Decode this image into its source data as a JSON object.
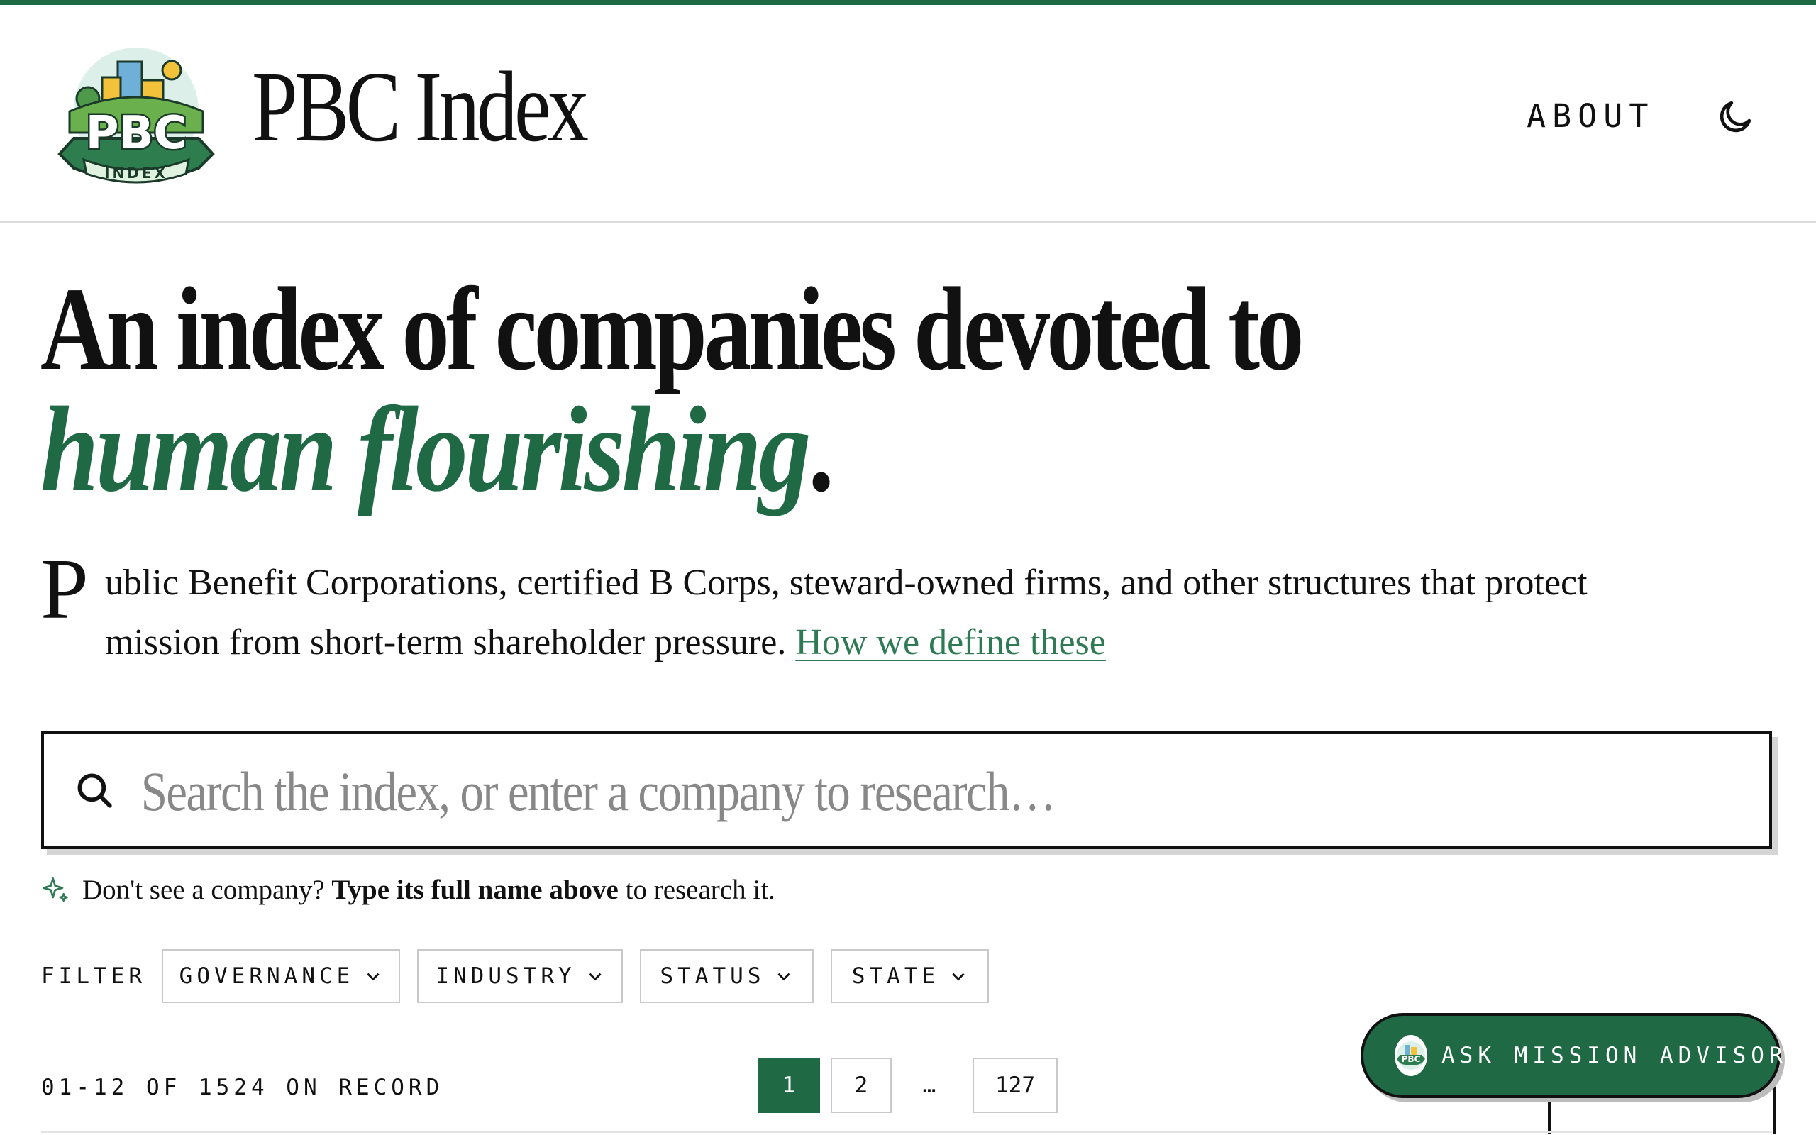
{
  "header": {
    "brand": "PBC Index",
    "logo_text": "PBC",
    "logo_ribbon": "INDEX",
    "nav_about": "ABOUT",
    "theme_icon": "moon-icon"
  },
  "hero": {
    "line1": "An index of companies devoted to",
    "line2_em": "human flourishing",
    "line2_end": ".",
    "dropcap": "P",
    "lede": "ublic Benefit Corporations, certified B Corps, steward-owned firms, and other structures that protect mission from short-term shareholder pressure.",
    "lede_link": "How we define these"
  },
  "search": {
    "placeholder": "Search the index, or enter a company to research…",
    "value": "",
    "icon": "search-icon"
  },
  "hint": {
    "prefix": "Don't see a company?",
    "bold": "Type its full name above",
    "suffix": "to research it.",
    "icon": "sparkle-icon"
  },
  "filters": {
    "label": "FILTER",
    "items": [
      "GOVERNANCE",
      "INDUSTRY",
      "STATUS",
      "STATE"
    ]
  },
  "pagination": {
    "summary": "01-12 OF 1524 ON RECORD",
    "pages": [
      "1",
      "2",
      "…",
      "127"
    ],
    "current": "1"
  },
  "advisor": {
    "label": "ASK MISSION ADVISOR",
    "badge_text": "PBC"
  },
  "colors": {
    "accent": "#1f6a45",
    "link": "#2f7a54",
    "text": "#111111",
    "border": "#c9c9c9"
  }
}
